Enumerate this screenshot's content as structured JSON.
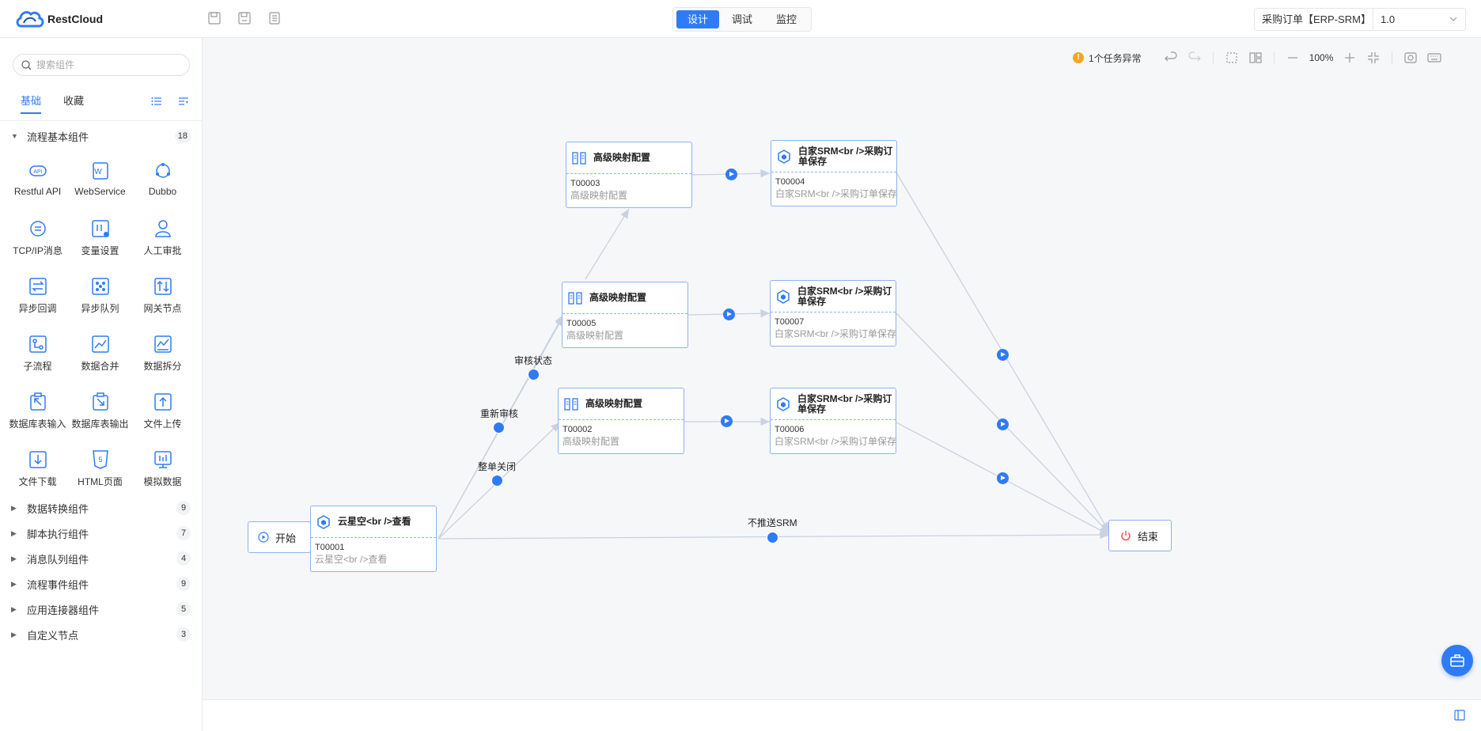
{
  "header": {
    "logo_text": "RestCloud",
    "toolbar_icons": [
      "save-icon",
      "save-as-icon",
      "document-icon"
    ],
    "mode_tabs": [
      {
        "label": "设计",
        "active": true
      },
      {
        "label": "调试",
        "active": false
      },
      {
        "label": "监控",
        "active": false
      }
    ],
    "flow_name": "采购订单【ERP-SRM】",
    "flow_version": "1.0"
  },
  "sidebar": {
    "search_placeholder": "搜索组件",
    "tabs": [
      {
        "label": "基础",
        "active": true
      },
      {
        "label": "收藏",
        "active": false
      }
    ],
    "groups": [
      {
        "name": "流程基本组件",
        "count": "18",
        "expanded": true
      },
      {
        "name": "数据转换组件",
        "count": "9",
        "expanded": false
      },
      {
        "name": "脚本执行组件",
        "count": "7",
        "expanded": false
      },
      {
        "name": "消息队列组件",
        "count": "4",
        "expanded": false
      },
      {
        "name": "流程事件组件",
        "count": "9",
        "expanded": false
      },
      {
        "name": "应用连接器组件",
        "count": "5",
        "expanded": false
      },
      {
        "name": "自定义节点",
        "count": "3",
        "expanded": false
      }
    ],
    "components": [
      {
        "label": "Restful API",
        "icon": "api-icon"
      },
      {
        "label": "WebService",
        "icon": "webservice-icon"
      },
      {
        "label": "Dubbo",
        "icon": "dubbo-icon"
      },
      {
        "label": "TCP/IP消息",
        "icon": "message-icon"
      },
      {
        "label": "变量设置",
        "icon": "variable-icon"
      },
      {
        "label": "人工审批",
        "icon": "user-icon"
      },
      {
        "label": "异步回调",
        "icon": "callback-icon"
      },
      {
        "label": "异步队列",
        "icon": "queue-icon"
      },
      {
        "label": "网关节点",
        "icon": "gateway-icon"
      },
      {
        "label": "子流程",
        "icon": "subprocess-icon"
      },
      {
        "label": "数据合并",
        "icon": "merge-icon"
      },
      {
        "label": "数据拆分",
        "icon": "split-icon"
      },
      {
        "label": "数据库表输入",
        "icon": "db-input-icon"
      },
      {
        "label": "数据库表输出",
        "icon": "db-output-icon"
      },
      {
        "label": "文件上传",
        "icon": "upload-icon"
      },
      {
        "label": "文件下载",
        "icon": "download-icon"
      },
      {
        "label": "HTML页面",
        "icon": "html-icon"
      },
      {
        "label": "模拟数据",
        "icon": "mock-data-icon"
      }
    ]
  },
  "canvas_toolbar": {
    "warning": "1个任务异常",
    "zoom": "100%"
  },
  "flow": {
    "start_label": "开始",
    "end_label": "结束",
    "nodes": [
      {
        "id": "T00001",
        "title": "云星空<br />查看",
        "subtitle": "云星空<br />查看",
        "kind": "cloud"
      },
      {
        "id": "T00003",
        "title": "高级映射配置",
        "subtitle": "高级映射配置",
        "kind": "mapping"
      },
      {
        "id": "T00005",
        "title": "高级映射配置",
        "subtitle": "高级映射配置",
        "kind": "mapping"
      },
      {
        "id": "T00002",
        "title": "高级映射配置",
        "subtitle": "高级映射配置",
        "kind": "mapping"
      },
      {
        "id": "T00004",
        "title": "白家SRM<br />采购订单保存",
        "subtitle": "白家SRM<br />采购订单保存",
        "kind": "cloud"
      },
      {
        "id": "T00007",
        "title": "白家SRM<br />采购订单保存",
        "subtitle": "白家SRM<br />采购订单保存",
        "kind": "cloud"
      },
      {
        "id": "T00006",
        "title": "白家SRM<br />采购订单保存",
        "subtitle": "白家SRM<br />采购订单保存",
        "kind": "cloud"
      }
    ],
    "edge_labels": [
      "审核状态",
      "重新审核",
      "整单关闭",
      "不推送SRM"
    ]
  },
  "colors": {
    "accent": "#2f7bf6",
    "node_border": "#8db3f2",
    "edge": "#c9d2e0",
    "warning": "#f5a623",
    "end_icon": "#f04b4b"
  }
}
